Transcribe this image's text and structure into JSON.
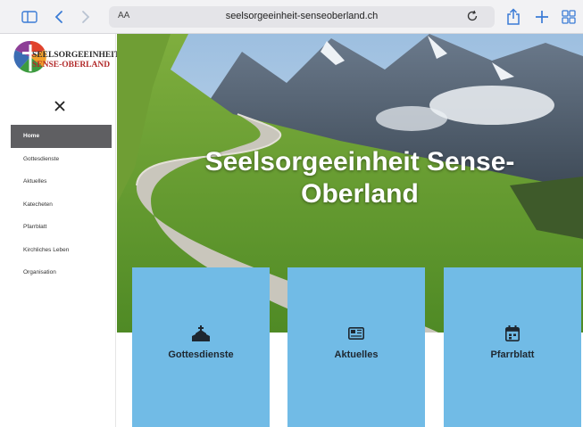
{
  "browser": {
    "url": "seelsorgeeinheit-senseoberland.ch",
    "aa_label": "AA",
    "icons": [
      "sidebar-icon",
      "back-icon",
      "forward-icon",
      "reload-icon",
      "share-icon",
      "plus-icon",
      "tabs-icon"
    ]
  },
  "nav": {
    "logo_line1": "SEELSORGEEINHEIT",
    "logo_line2": "SENSE-OBERLAND",
    "close_icon": "close-icon",
    "items": [
      {
        "label": "Home",
        "active": true
      },
      {
        "label": "Gottesdienste",
        "active": false
      },
      {
        "label": "Aktuelles",
        "active": false
      },
      {
        "label": "Katecheten",
        "active": false
      },
      {
        "label": "Pfarrblatt",
        "active": false
      },
      {
        "label": "Kirchliches Leben",
        "active": false
      },
      {
        "label": "Organisation",
        "active": false
      }
    ]
  },
  "hero": {
    "title": "Seelsorgeeinheit Sense-Oberland"
  },
  "tiles": [
    {
      "label": "Gottesdienste",
      "icon": "church-icon"
    },
    {
      "label": "Aktuelles",
      "icon": "newspaper-icon"
    },
    {
      "label": "Pfarrblatt",
      "icon": "calendar-icon"
    }
  ],
  "colors": {
    "tile": "#71bbe6",
    "nav_active": "#5f5f62",
    "toolbar_accent": "#3a7bd5"
  }
}
